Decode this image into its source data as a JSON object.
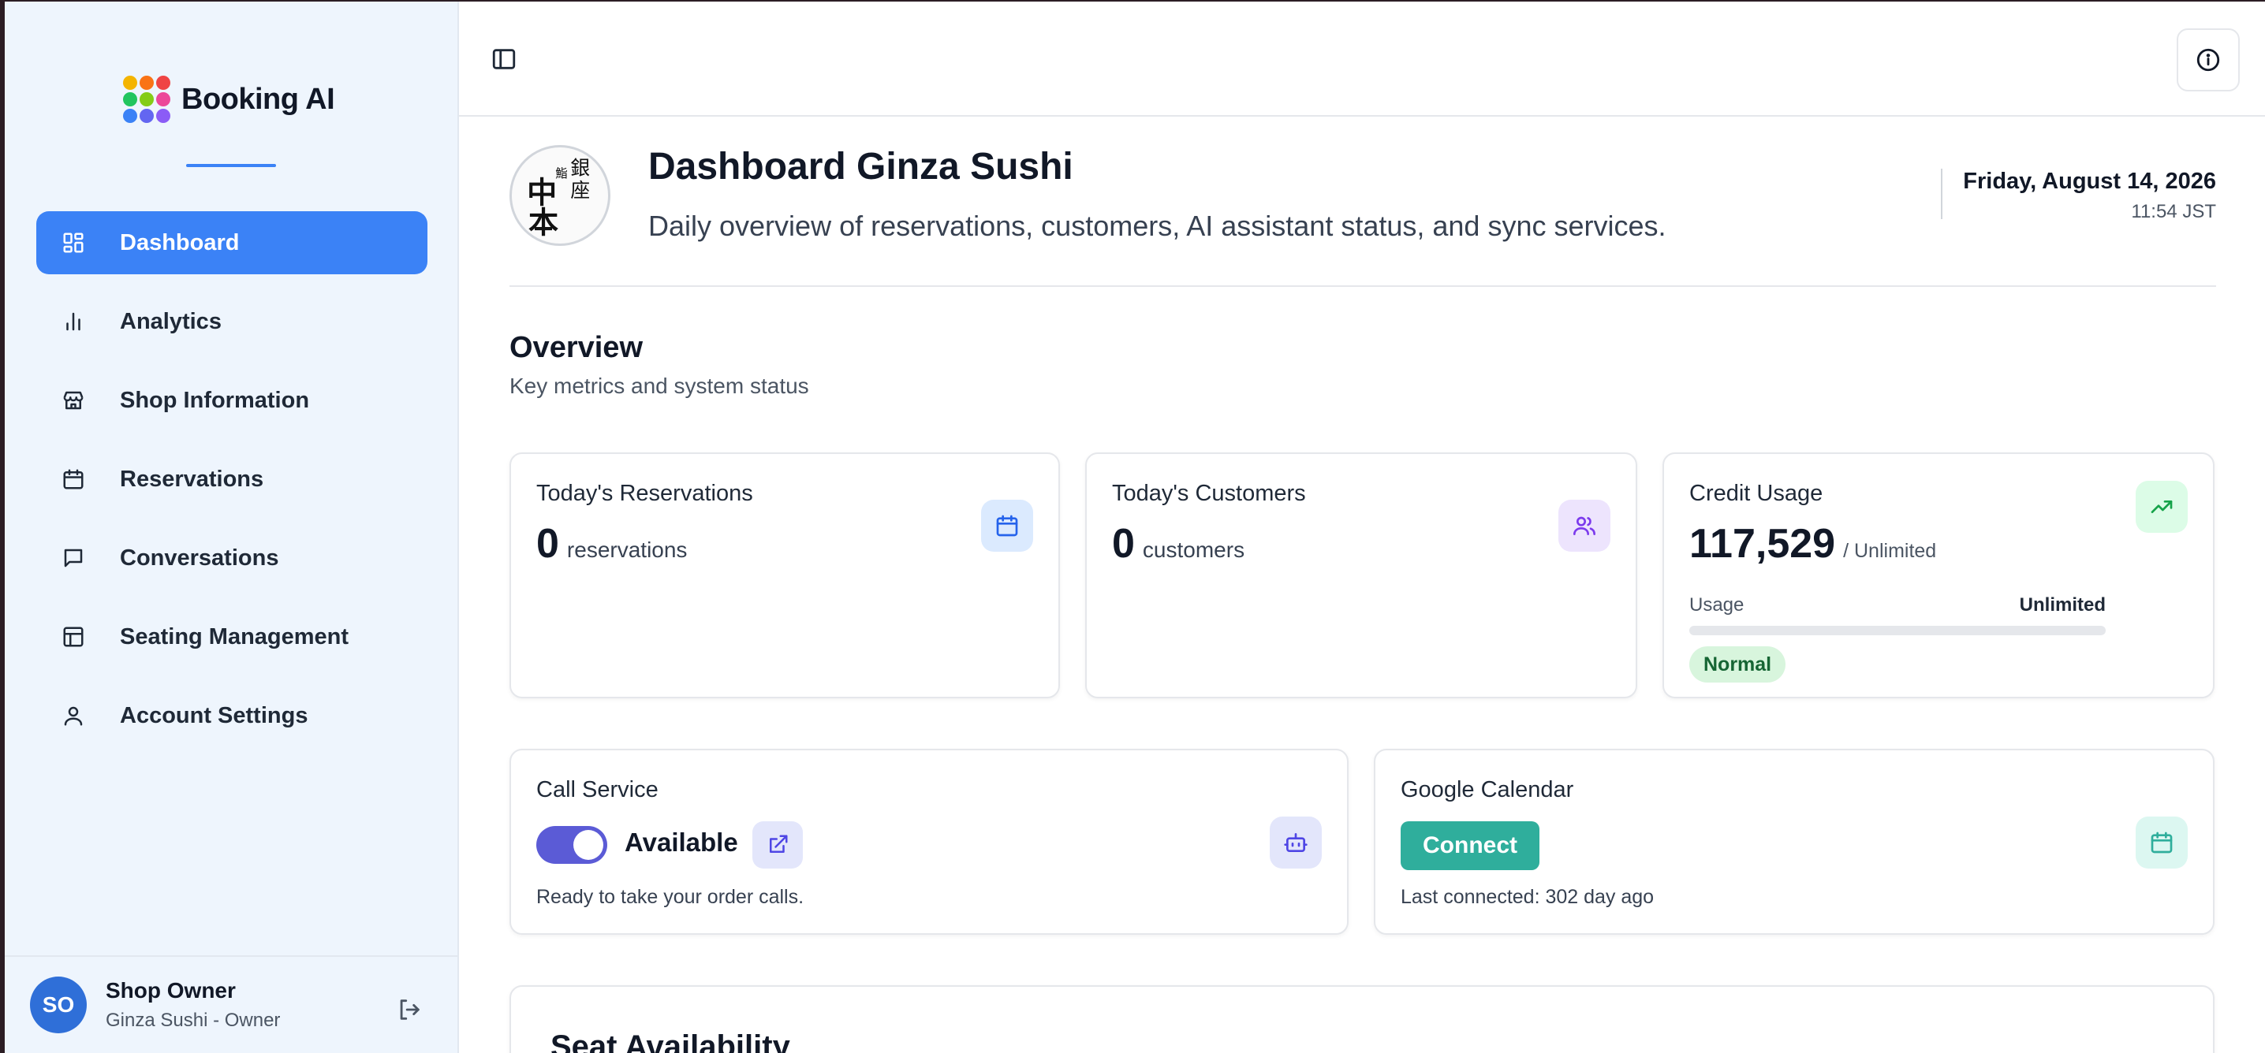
{
  "app": {
    "name": "Booking AI"
  },
  "sidebar": {
    "items": [
      {
        "label": "Dashboard",
        "icon": "dashboard-grid-icon",
        "active": true
      },
      {
        "label": "Analytics",
        "icon": "bar-chart-icon"
      },
      {
        "label": "Shop Information",
        "icon": "store-icon"
      },
      {
        "label": "Reservations",
        "icon": "calendar-icon"
      },
      {
        "label": "Conversations",
        "icon": "chat-bubble-icon"
      },
      {
        "label": "Seating Management",
        "icon": "layout-icon"
      },
      {
        "label": "Account Settings",
        "icon": "user-icon"
      }
    ],
    "user": {
      "initials": "SO",
      "name": "Shop Owner",
      "role": "Ginza Sushi - Owner"
    }
  },
  "header": {
    "title": "Dashboard Ginza Sushi",
    "subtitle": "Daily overview of reservations, customers, AI assistant status, and sync services.",
    "date": "Friday, August 14, 2026",
    "time": "11:54 JST"
  },
  "overview": {
    "title": "Overview",
    "subtitle": "Key metrics and system status",
    "cards": {
      "reservations": {
        "label": "Today's Reservations",
        "value": "0",
        "unit": "reservations"
      },
      "customers": {
        "label": "Today's Customers",
        "value": "0",
        "unit": "customers"
      },
      "credit": {
        "label": "Credit Usage",
        "value": "117,529",
        "unit": "/ Unlimited",
        "usage_label": "Usage",
        "usage_value": "Unlimited",
        "usage_fraction": 0,
        "status": "Normal"
      },
      "call_service": {
        "label": "Call Service",
        "status": "Available",
        "enabled": true,
        "note": "Ready to take your order calls."
      },
      "google_calendar": {
        "label": "Google Calendar",
        "button": "Connect",
        "note": "Last connected: 302 day ago"
      }
    }
  },
  "seat_availability": {
    "title": "Seat Availability"
  },
  "colors": {
    "accent": "#3b82f6",
    "sidebar_bg": "#eef5fd",
    "toggle": "#5b5bd6",
    "connect": "#2fae9c",
    "normal_badge": "#d8f5dd"
  }
}
